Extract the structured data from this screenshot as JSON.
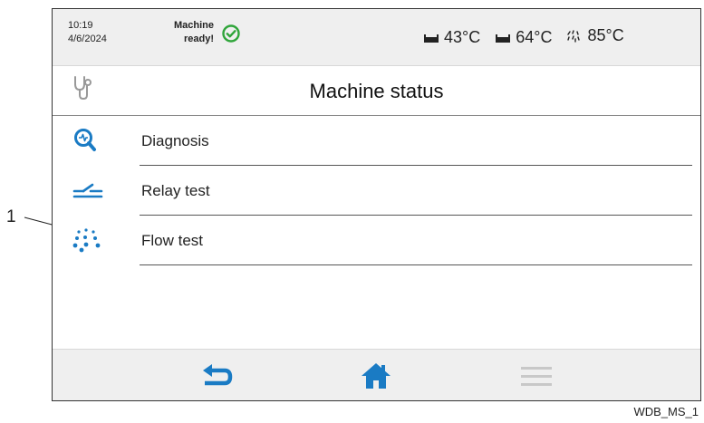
{
  "callout": {
    "number": "1"
  },
  "status": {
    "time": "10:19",
    "date": "4/6/2024",
    "machine_line1": "Machine",
    "machine_line2": "ready!",
    "state_color": "#33aa33",
    "temps": [
      {
        "icon": "tank-icon",
        "value": "43°C"
      },
      {
        "icon": "tank-icon",
        "value": "64°C"
      },
      {
        "icon": "rinse-spray-icon",
        "value": "85°C"
      }
    ]
  },
  "header": {
    "title": "Machine status",
    "icon": "stethoscope-icon"
  },
  "menu": {
    "accent": "#1a7bc4",
    "items": [
      {
        "label": "Diagnosis",
        "icon": "diagnosis-magnifier-icon"
      },
      {
        "label": "Relay test",
        "icon": "relay-switch-icon"
      },
      {
        "label": "Flow test",
        "icon": "water-drops-icon"
      }
    ]
  },
  "footer": {
    "buttons": [
      {
        "name": "back",
        "icon": "back-arrow-icon"
      },
      {
        "name": "home",
        "icon": "home-icon"
      },
      {
        "name": "menu",
        "icon": "hamburger-menu-icon"
      }
    ]
  },
  "figure_code": "WDB_MS_1"
}
